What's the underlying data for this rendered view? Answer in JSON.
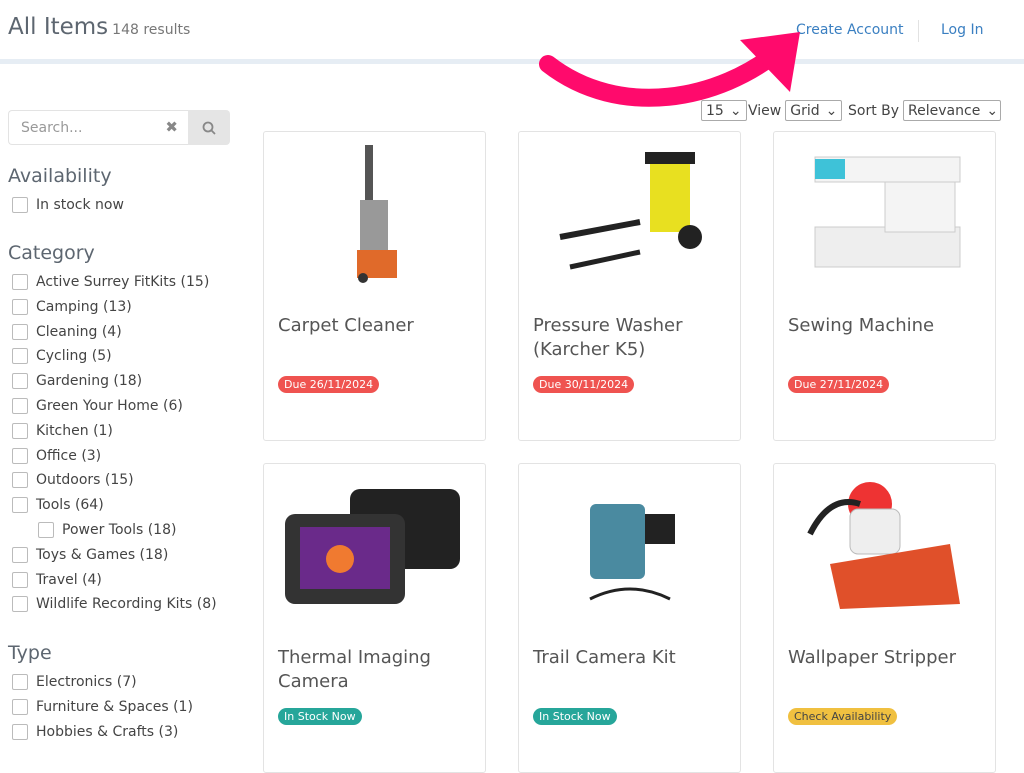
{
  "header": {
    "title": "All Items",
    "count": "148 results",
    "create_account": "Create Account",
    "login": "Log In"
  },
  "sidebar": {
    "search_placeholder": "Search...",
    "availability": {
      "title": "Availability",
      "items": [
        "In stock now"
      ]
    },
    "category": {
      "title": "Category",
      "items": [
        "Active Surrey FitKits (15)",
        "Camping (13)",
        "Cleaning (4)",
        "Cycling (5)",
        "Gardening (18)",
        "Green Your Home (6)",
        "Kitchen (1)",
        "Office (3)",
        "Outdoors (15)",
        "Tools (64)",
        "Power Tools (18)",
        "Toys & Games (18)",
        "Travel (4)",
        "Wildlife Recording Kits (8)"
      ]
    },
    "type": {
      "title": "Type",
      "items": [
        "Electronics (7)",
        "Furniture & Spaces (1)",
        "Hobbies & Crafts (3)"
      ]
    }
  },
  "controls": {
    "show_value": "15",
    "view_label": "View",
    "view_value": "Grid",
    "sort_label": "Sort By",
    "sort_value": "Relevance"
  },
  "items": [
    {
      "name": "Carpet Cleaner",
      "badge": "Due 26/11/2024",
      "status": "due"
    },
    {
      "name": "Pressure Washer (Karcher K5)",
      "badge": "Due 30/11/2024",
      "status": "due"
    },
    {
      "name": "Sewing Machine",
      "badge": "Due 27/11/2024",
      "status": "due"
    },
    {
      "name": "Thermal Imaging Camera",
      "badge": "In Stock Now",
      "status": "in-stock"
    },
    {
      "name": "Trail Camera Kit",
      "badge": "In Stock Now",
      "status": "in-stock"
    },
    {
      "name": "Wallpaper Stripper",
      "badge": "Check Availability",
      "status": "check"
    }
  ],
  "colors": {
    "due": "#ef5350",
    "in-stock": "#26a69a",
    "check": "#f0c040",
    "link": "#3a7fc1",
    "arrow": "#ff0a6c"
  }
}
